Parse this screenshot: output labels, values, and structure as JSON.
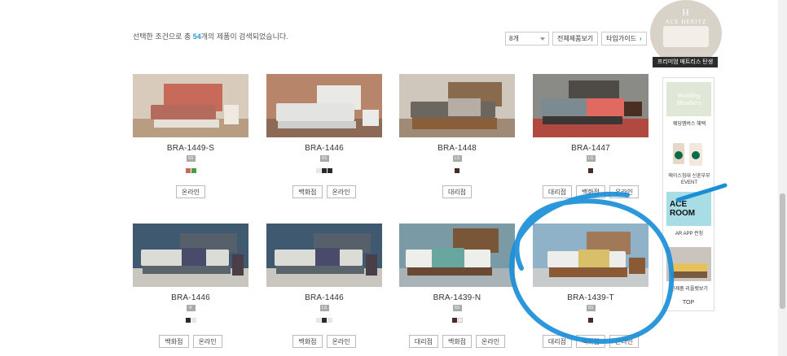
{
  "result": {
    "prefix": "선택한 조건으로 총 ",
    "count": "54",
    "suffix": "개의 제품이 검색되었습니다."
  },
  "controls": {
    "per_page": "8개",
    "view_all": "전체제품보기",
    "type_guide": "타입가이드"
  },
  "products": [
    {
      "name": "BRA-1449-S",
      "size": "SS",
      "swatches": [
        "#c86a5a",
        "#4a9a4a"
      ],
      "buttons": [
        "온라인"
      ]
    },
    {
      "name": "BRA-1446",
      "size": "SS",
      "swatches": [
        "#e6e6e6",
        "#2a2a2a",
        "#2a2a2a"
      ],
      "buttons": [
        "백화점",
        "온라인"
      ]
    },
    {
      "name": "BRA-1448",
      "size": "LS",
      "swatches": [
        "#4a2a22"
      ],
      "buttons": [
        "대리점"
      ]
    },
    {
      "name": "BRA-1447",
      "size": "LS",
      "swatches": [
        "#4a2a22"
      ],
      "buttons": [
        "대리점",
        "백화점",
        "온라인"
      ]
    },
    {
      "name": "BRA-1446",
      "size": "K",
      "swatches": [
        "#2a2a2a",
        "#e6e6e6"
      ],
      "buttons": [
        "백화점",
        "온라인"
      ]
    },
    {
      "name": "BRA-1446",
      "size": "LS",
      "swatches": [
        "#e6e6e6",
        "#2a2a2a",
        "#e6e6e6"
      ],
      "buttons": [
        "백화점",
        "온라인"
      ]
    },
    {
      "name": "BRA-1439-N",
      "size": "SS",
      "swatches": [
        "#4a2a22",
        "#f0f0f0"
      ],
      "buttons": [
        "대리점",
        "백화점",
        "온라인"
      ]
    },
    {
      "name": "BRA-1439-T",
      "size": "SS",
      "swatches": [
        "#4a2a22"
      ],
      "buttons": [
        "대리점",
        "백화점",
        "온라인"
      ]
    }
  ],
  "promo": {
    "logo_line1": "H",
    "logo_line2": "ACE HERITZ",
    "banner": "프리미엄 매트리스 탄생"
  },
  "side": {
    "items": [
      {
        "thumb_text": "Wedding Members",
        "label": "웨딩멤버스 혜택"
      },
      {
        "thumb_text": "",
        "label": "에이스침대 신혼부부 EVENT"
      },
      {
        "thumb_text": "ACE ROOM",
        "label": "AR APP 런칭"
      },
      {
        "thumb_text": "",
        "label": "신제품 리플렛보기"
      }
    ],
    "top": "TOP"
  },
  "colors": {
    "accent": "#2a9ad8",
    "annotation": "#1a8fd8"
  }
}
